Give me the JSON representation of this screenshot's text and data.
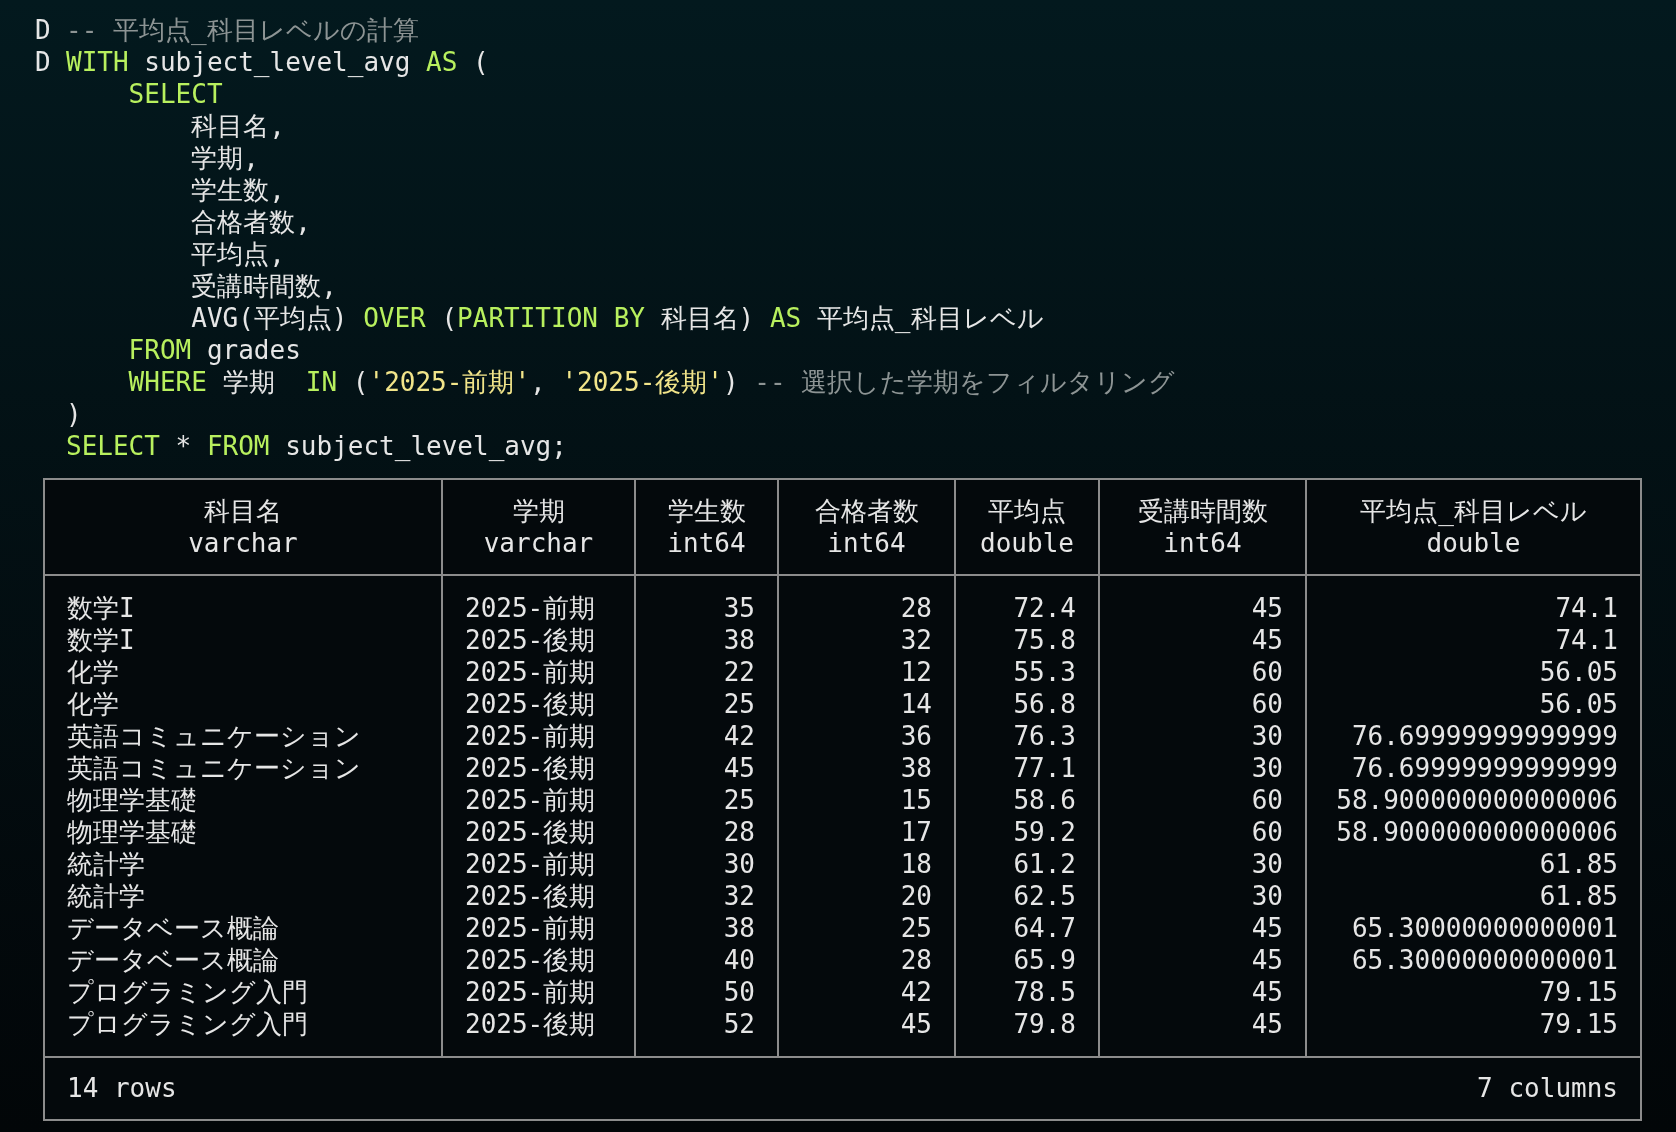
{
  "code_lines": [
    {
      "marker": "D",
      "tokens": [
        {
          "kind": "comment",
          "text": "-- 平均点_科目レベルの計算"
        }
      ]
    },
    {
      "marker": "D",
      "tokens": [
        {
          "kind": "keyword",
          "text": "WITH"
        },
        {
          "kind": "plain",
          "text": " subject_level_avg "
        },
        {
          "kind": "keyword",
          "text": "AS"
        },
        {
          "kind": "plain",
          "text": " ("
        }
      ]
    },
    {
      "tokens": [
        {
          "kind": "keyword",
          "text": "    SELECT"
        }
      ]
    },
    {
      "tokens": [
        {
          "kind": "plain",
          "text": "        科目名,"
        }
      ]
    },
    {
      "tokens": [
        {
          "kind": "plain",
          "text": "        学期,"
        }
      ]
    },
    {
      "tokens": [
        {
          "kind": "plain",
          "text": "        学生数,"
        }
      ]
    },
    {
      "tokens": [
        {
          "kind": "plain",
          "text": "        合格者数,"
        }
      ]
    },
    {
      "tokens": [
        {
          "kind": "plain",
          "text": "        平均点,"
        }
      ]
    },
    {
      "tokens": [
        {
          "kind": "plain",
          "text": "        受講時間数,"
        }
      ]
    },
    {
      "tokens": [
        {
          "kind": "plain",
          "text": "        AVG(平均点) "
        },
        {
          "kind": "keyword",
          "text": "OVER"
        },
        {
          "kind": "plain",
          "text": " ("
        },
        {
          "kind": "keyword",
          "text": "PARTITION BY"
        },
        {
          "kind": "plain",
          "text": " 科目名) "
        },
        {
          "kind": "keyword",
          "text": "AS"
        },
        {
          "kind": "plain",
          "text": " 平均点_科目レベル"
        }
      ]
    },
    {
      "tokens": [
        {
          "kind": "keyword",
          "text": "    FROM"
        },
        {
          "kind": "plain",
          "text": " grades"
        }
      ]
    },
    {
      "tokens": [
        {
          "kind": "keyword",
          "text": "    WHERE"
        },
        {
          "kind": "plain",
          "text": " 学期 "
        },
        {
          "kind": "keyword",
          "text": " IN"
        },
        {
          "kind": "plain",
          "text": " ("
        },
        {
          "kind": "string",
          "text": "'2025-前期'"
        },
        {
          "kind": "plain",
          "text": ", "
        },
        {
          "kind": "string",
          "text": "'2025-後期'"
        },
        {
          "kind": "plain",
          "text": ") "
        },
        {
          "kind": "comment",
          "text": "-- 選択した学期をフィルタリング"
        }
      ]
    },
    {
      "tokens": [
        {
          "kind": "plain",
          "text": ")"
        }
      ]
    },
    {
      "tokens": [
        {
          "kind": "keyword",
          "text": "SELECT"
        },
        {
          "kind": "plain",
          "text": " * "
        },
        {
          "kind": "keyword",
          "text": "FROM"
        },
        {
          "kind": "plain",
          "text": " subject_level_avg;"
        }
      ]
    }
  ],
  "table": {
    "columns": [
      {
        "name": "科目名",
        "type": "varchar"
      },
      {
        "name": "学期",
        "type": "varchar"
      },
      {
        "name": "学生数",
        "type": "int64"
      },
      {
        "name": "合格者数",
        "type": "int64"
      },
      {
        "name": "平均点",
        "type": "double"
      },
      {
        "name": "受講時間数",
        "type": "int64"
      },
      {
        "name": "平均点_科目レベル",
        "type": "double"
      }
    ],
    "rows": [
      [
        "数学I",
        "2025-前期",
        "35",
        "28",
        "72.4",
        "45",
        "74.1"
      ],
      [
        "数学I",
        "2025-後期",
        "38",
        "32",
        "75.8",
        "45",
        "74.1"
      ],
      [
        "化学",
        "2025-前期",
        "22",
        "12",
        "55.3",
        "60",
        "56.05"
      ],
      [
        "化学",
        "2025-後期",
        "25",
        "14",
        "56.8",
        "60",
        "56.05"
      ],
      [
        "英語コミュニケーション",
        "2025-前期",
        "42",
        "36",
        "76.3",
        "30",
        "76.69999999999999"
      ],
      [
        "英語コミュニケーション",
        "2025-後期",
        "45",
        "38",
        "77.1",
        "30",
        "76.69999999999999"
      ],
      [
        "物理学基礎",
        "2025-前期",
        "25",
        "15",
        "58.6",
        "60",
        "58.900000000000006"
      ],
      [
        "物理学基礎",
        "2025-後期",
        "28",
        "17",
        "59.2",
        "60",
        "58.900000000000006"
      ],
      [
        "統計学",
        "2025-前期",
        "30",
        "18",
        "61.2",
        "30",
        "61.85"
      ],
      [
        "統計学",
        "2025-後期",
        "32",
        "20",
        "62.5",
        "30",
        "61.85"
      ],
      [
        "データベース概論",
        "2025-前期",
        "38",
        "25",
        "64.7",
        "45",
        "65.30000000000001"
      ],
      [
        "データベース概論",
        "2025-後期",
        "40",
        "28",
        "65.9",
        "45",
        "65.30000000000001"
      ],
      [
        "プログラミング入門",
        "2025-前期",
        "50",
        "42",
        "78.5",
        "45",
        "79.15"
      ],
      [
        "プログラミング入門",
        "2025-後期",
        "52",
        "45",
        "79.8",
        "45",
        "79.15"
      ]
    ],
    "footer": {
      "row_count": "14 rows",
      "column_count": "7 columns"
    }
  }
}
